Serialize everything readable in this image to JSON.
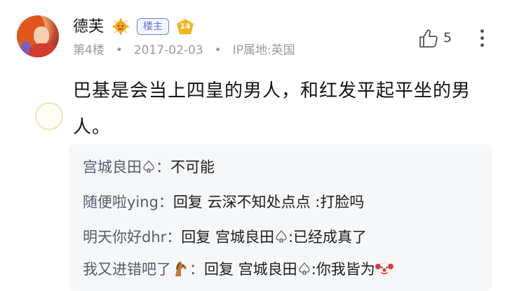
{
  "post": {
    "username": "德芙",
    "owner_badge": "楼主",
    "level": "14",
    "floor": "第4楼",
    "date": "2017-02-03",
    "ip": "IP属地:英国",
    "likes": "5",
    "content": "巴基是会当上四皇的男人，和红发平起平坐的男人。"
  },
  "replies": [
    {
      "name": "宫城良田",
      "colon": "：",
      "text": "不可能"
    },
    {
      "name": "随便啦ying",
      "colon": "：",
      "text": "回复 云深不知处点点 :打脸吗"
    },
    {
      "name": "明天你好dhr",
      "colon": "：",
      "reply_word": "回复",
      "target": "宫城良田",
      "text": ":已经成真了"
    },
    {
      "name": "我又进错吧了",
      "colon": "：",
      "reply_word": "回复",
      "target": "宫城良田",
      "text": ":你我皆为"
    }
  ],
  "icons": {
    "sun": "sun-icon",
    "level": "level-badge-icon",
    "like": "thumbs-up-icon",
    "more": "more-vertical-icon",
    "spade": "spade-icon",
    "horse": "horse-emoji",
    "clown": "clown-emoji"
  },
  "colors": {
    "badge_blue": "#5b6fd0",
    "level_gold": "#f0b51e",
    "reply_bg": "#f6f7f9"
  }
}
